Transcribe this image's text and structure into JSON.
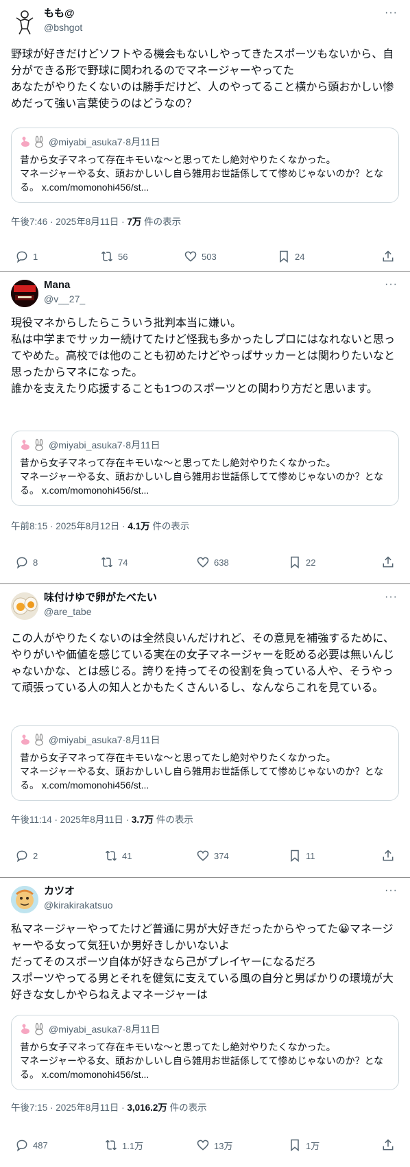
{
  "posts": [
    {
      "name": "もも@",
      "handle": "@bshgot",
      "body": "野球が好きだけどソフトやる機会もないしやってきたスポーツもないから、自分ができる形で野球に関われるのでマネージャーやってた\nあなたがやりたくないのは勝手だけど、人のやってること横から頭おかしい惨めだって強い言葉使うのはどうなの？",
      "quote": {
        "handle": "@miyabi_asuka7",
        "date": "8月11日",
        "text": "昔から女子マネって存在キモいな〜と思ってたし絶対やりたくなかった。\nマネージャーやる女、頭おかしいし自ら雑用お世話係してて惨めじゃないのか？となる。 x.com/momonohi456/st..."
      },
      "time": "午後7:46 · 2025年8月11日 · ",
      "views": "7万",
      "views_suffix": " 件の表示",
      "replies": "1",
      "reposts": "56",
      "likes": "503",
      "bookmarks": "24"
    },
    {
      "name": "Mana",
      "handle": "@v__27_",
      "body": "現役マネからしたらこういう批判本当に嫌い。\n私は中学までサッカー続けてたけど怪我も多かったしプロにはなれないと思ってやめた。高校では他のことも初めたけどやっぱサッカーとは関わりたいなと思ったからマネになった。\n誰かを支えたり応援することも1つのスポーツとの関わり方だと思います。",
      "quote": {
        "handle": "@miyabi_asuka7",
        "date": "8月11日",
        "text": "昔から女子マネって存在キモいな〜と思ってたし絶対やりたくなかった。\nマネージャーやる女、頭おかしいし自ら雑用お世話係してて惨めじゃないのか？となる。 x.com/momonohi456/st..."
      },
      "time": "午前8:15 · 2025年8月12日 · ",
      "views": "4.1万",
      "views_suffix": " 件の表示",
      "replies": "8",
      "reposts": "74",
      "likes": "638",
      "bookmarks": "22"
    },
    {
      "name": "味付けゆで卵がたべたい",
      "handle": "@are_tabe",
      "body": "この人がやりたくないのは全然良いんだけれど、その意見を補強するために、やりがいや価値を感じている実在の女子マネージャーを貶める必要は無いんじゃないかな、とは感じる。誇りを持ってその役割を負っている人や、そうやって頑張っている人の知人とかもたくさんいるし、なんならこれを見ている。",
      "quote": {
        "handle": "@miyabi_asuka7",
        "date": "8月11日",
        "text": "昔から女子マネって存在キモいな〜と思ってたし絶対やりたくなかった。\nマネージャーやる女、頭おかしいし自ら雑用お世話係してて惨めじゃないのか？となる。 x.com/momonohi456/st..."
      },
      "time": "午後11:14 · 2025年8月11日 · ",
      "views": "3.7万",
      "views_suffix": " 件の表示",
      "replies": "2",
      "reposts": "41",
      "likes": "374",
      "bookmarks": "11"
    },
    {
      "name": "カツオ",
      "handle": "@kirakirakatsuo",
      "body": "私マネージャーやってたけど普通に男が大好きだったからやってた😀マネージャーやる女って気狂いか男好きしかいないよ\nだってそのスポーツ自体が好きなら己がプレイヤーになるだろ\nスポーツやってる男とそれを健気に支えている風の自分と男ばかりの環境が大好きな女しかやらねえよマネージャーは",
      "quote": {
        "handle": "@miyabi_asuka7",
        "date": "8月11日",
        "text": "昔から女子マネって存在キモいな〜と思ってたし絶対やりたくなかった。\nマネージャーやる女、頭おかしいし自ら雑用お世話係してて惨めじゃないのか？となる。 x.com/momonohi456/st..."
      },
      "time": "午後7:15 · 2025年8月11日 · ",
      "views": "3,016.2万",
      "views_suffix": " 件の表示",
      "replies": "487",
      "reposts": "1.1万",
      "likes": "13万",
      "bookmarks": "1万"
    }
  ],
  "ui": {
    "more": "···",
    "dot": " · "
  },
  "colors": {
    "text": "#0f1419",
    "secondary": "#536471",
    "border": "#cfd9de",
    "divider": "#7a7a7a"
  }
}
